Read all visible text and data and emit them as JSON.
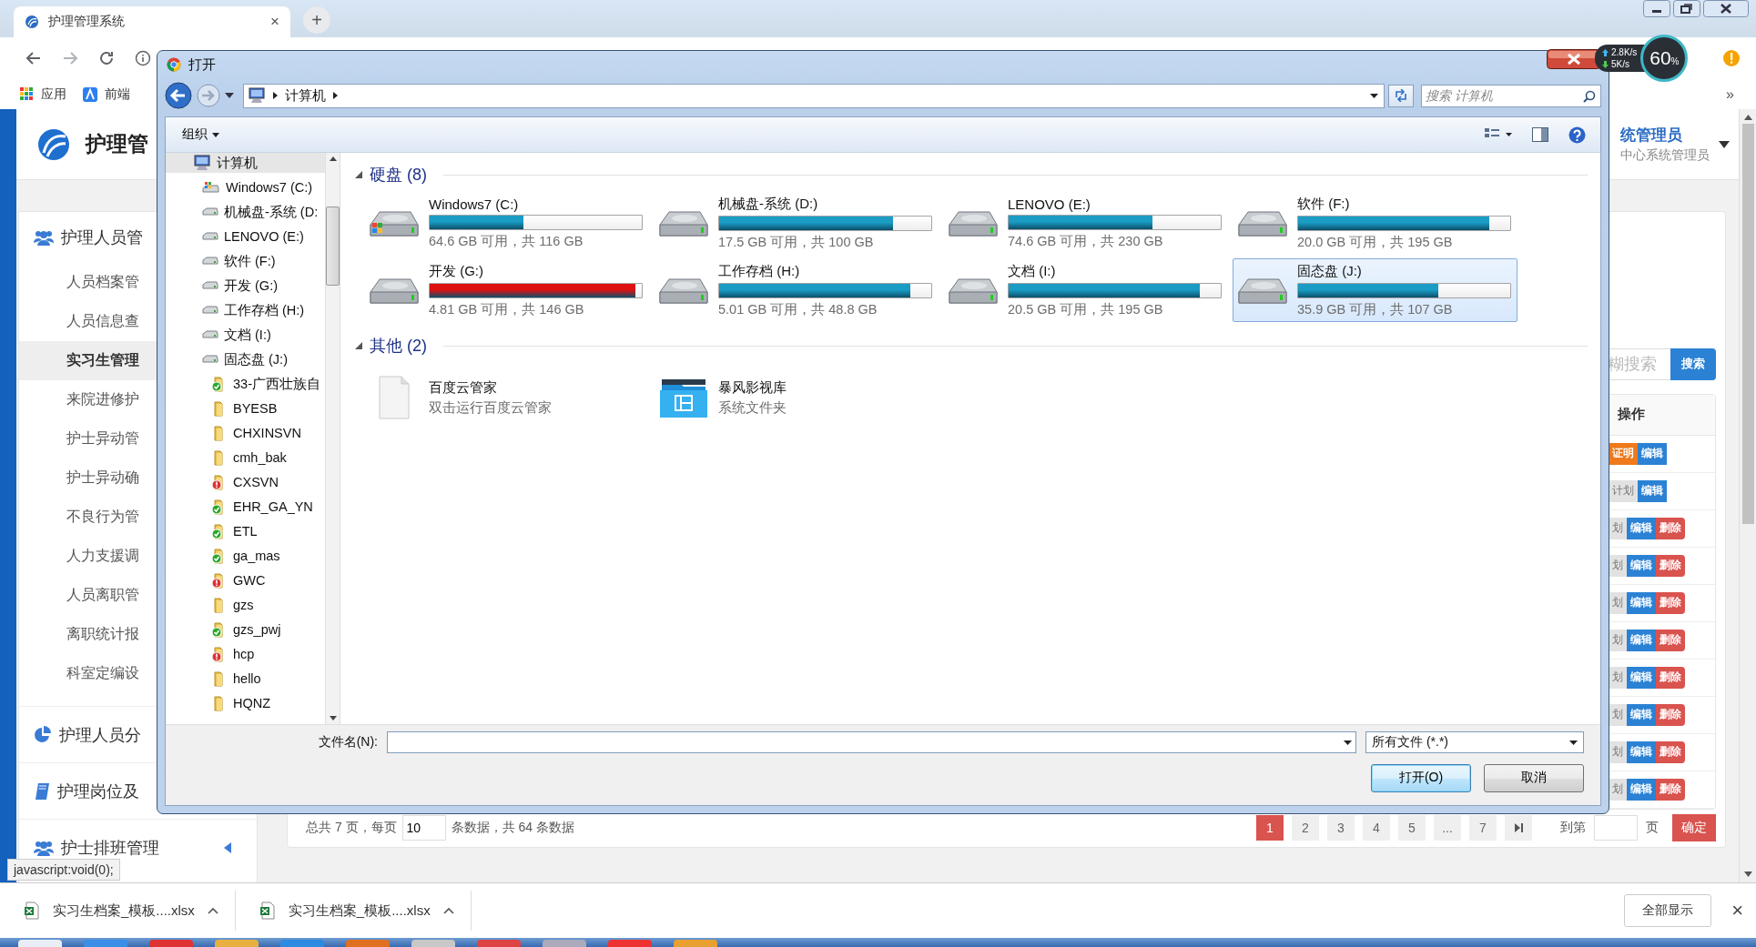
{
  "browser": {
    "tab": {
      "title": "护理管理系统",
      "close": "×"
    },
    "new_tab": "+",
    "bookmarks": [
      {
        "label": "应用",
        "kind": "apps"
      },
      {
        "label": "前端",
        "kind": "page"
      }
    ],
    "overflow": "»"
  },
  "speed_widget": {
    "up": "2.8K/s",
    "down": "5K/s",
    "percent": "60",
    "unit": "%"
  },
  "app": {
    "title": "护理管",
    "user": {
      "name": "统管理员",
      "role": "中心系统管理员"
    },
    "sidebar": [
      {
        "label": "护理人员管",
        "kind": "users",
        "children": [
          {
            "label": "人员档案管",
            "selected": false
          },
          {
            "label": "人员信息查",
            "selected": false
          },
          {
            "label": "实习生管理",
            "selected": true
          },
          {
            "label": "来院进修护",
            "selected": false
          },
          {
            "label": "护士异动管",
            "selected": false
          },
          {
            "label": "护士异动确",
            "selected": false
          },
          {
            "label": "不良行为管",
            "selected": false
          },
          {
            "label": "人力支援调",
            "selected": false
          },
          {
            "label": "人员离职管",
            "selected": false
          },
          {
            "label": "离职统计报",
            "selected": false
          },
          {
            "label": "科室定编设",
            "selected": false
          }
        ]
      },
      {
        "label": "护理人员分",
        "kind": "pie"
      },
      {
        "label": "护理岗位及",
        "kind": "book"
      },
      {
        "label": "护士排班管理",
        "kind": "users",
        "collapsed": true
      }
    ],
    "search": {
      "placeholder": "糊搜索",
      "button": "搜索"
    },
    "table": {
      "column": "操作",
      "rows": [
        {
          "actions": [
            {
              "label": "证明",
              "kind": "warning"
            },
            {
              "label": "编辑",
              "kind": "primary"
            }
          ]
        },
        {
          "actions": [
            {
              "label": "计划",
              "kind": "plain"
            },
            {
              "label": "编辑",
              "kind": "primary"
            }
          ]
        },
        {
          "actions": [
            {
              "label": "划",
              "kind": "plain"
            },
            {
              "label": "编辑",
              "kind": "primary"
            },
            {
              "label": "删除",
              "kind": "danger"
            }
          ]
        },
        {
          "actions": [
            {
              "label": "划",
              "kind": "plain"
            },
            {
              "label": "编辑",
              "kind": "primary"
            },
            {
              "label": "删除",
              "kind": "danger"
            }
          ]
        },
        {
          "actions": [
            {
              "label": "划",
              "kind": "plain"
            },
            {
              "label": "编辑",
              "kind": "primary"
            },
            {
              "label": "删除",
              "kind": "danger"
            }
          ]
        },
        {
          "actions": [
            {
              "label": "划",
              "kind": "plain"
            },
            {
              "label": "编辑",
              "kind": "primary"
            },
            {
              "label": "删除",
              "kind": "danger"
            }
          ]
        },
        {
          "actions": [
            {
              "label": "划",
              "kind": "plain"
            },
            {
              "label": "编辑",
              "kind": "primary"
            },
            {
              "label": "删除",
              "kind": "danger"
            }
          ]
        },
        {
          "actions": [
            {
              "label": "划",
              "kind": "plain"
            },
            {
              "label": "编辑",
              "kind": "primary"
            },
            {
              "label": "删除",
              "kind": "danger"
            }
          ]
        },
        {
          "actions": [
            {
              "label": "划",
              "kind": "plain"
            },
            {
              "label": "编辑",
              "kind": "primary"
            },
            {
              "label": "删除",
              "kind": "danger"
            }
          ]
        },
        {
          "actions": [
            {
              "label": "划",
              "kind": "plain"
            },
            {
              "label": "编辑",
              "kind": "primary"
            },
            {
              "label": "删除",
              "kind": "danger"
            }
          ]
        }
      ]
    },
    "pagination": {
      "summary_prefix": "总共 7 页，每页",
      "page_size": "10",
      "summary_suffix": "条数据，共 64 条数据",
      "pages": [
        {
          "label": "1",
          "selected": true
        },
        {
          "label": "2",
          "selected": false
        },
        {
          "label": "3",
          "selected": false
        },
        {
          "label": "4",
          "selected": false
        },
        {
          "label": "5",
          "selected": false
        },
        {
          "label": "...",
          "selected": false
        },
        {
          "label": "7",
          "selected": false
        }
      ],
      "goto_label": "到第",
      "page_unit": "页",
      "confirm": "确定"
    }
  },
  "dialog": {
    "title": "打开",
    "path": [
      "计算机"
    ],
    "search_placeholder": "搜索 计算机",
    "organize": "组织",
    "tree": [
      {
        "label": "计算机",
        "kind": "computer",
        "selected": true,
        "children": [
          {
            "label": "Windows7 (C:)",
            "kind": "system-drive",
            "selected": false
          },
          {
            "label": "机械盘-系统 (D:",
            "kind": "drive",
            "selected": false
          },
          {
            "label": "LENOVO (E:)",
            "kind": "drive",
            "selected": false
          },
          {
            "label": "软件 (F:)",
            "kind": "drive",
            "selected": false
          },
          {
            "label": "开发 (G:)",
            "kind": "drive",
            "selected": false
          },
          {
            "label": "工作存档 (H:)",
            "kind": "drive",
            "selected": false
          },
          {
            "label": "文档 (I:)",
            "kind": "drive",
            "selected": false
          },
          {
            "label": "固态盘 (J:)",
            "kind": "drive",
            "selected": false,
            "children": [
              {
                "label": "33-广西壮族自",
                "kind": "folder-ok",
                "selected": false
              },
              {
                "label": "BYESB",
                "kind": "folder",
                "selected": false
              },
              {
                "label": "CHXINSVN",
                "kind": "folder",
                "selected": false
              },
              {
                "label": "cmh_bak",
                "kind": "folder",
                "selected": false
              },
              {
                "label": "CXSVN",
                "kind": "folder-error",
                "selected": false
              },
              {
                "label": "EHR_GA_YN",
                "kind": "folder-ok",
                "selected": false
              },
              {
                "label": "ETL",
                "kind": "folder-ok",
                "selected": false
              },
              {
                "label": "ga_mas",
                "kind": "folder-ok",
                "selected": false
              },
              {
                "label": "GWC",
                "kind": "folder-error",
                "selected": false
              },
              {
                "label": "gzs",
                "kind": "folder",
                "selected": false
              },
              {
                "label": "gzs_pwj",
                "kind": "folder-ok",
                "selected": false
              },
              {
                "label": "hcp",
                "kind": "folder-error",
                "selected": false
              },
              {
                "label": "hello",
                "kind": "folder",
                "selected": false
              },
              {
                "label": "HQNZ",
                "kind": "folder",
                "selected": false
              }
            ]
          }
        ]
      }
    ],
    "sections": [
      {
        "title": "硬盘 (8)",
        "kind": "drives",
        "items": [
          {
            "name": "Windows7 (C:)",
            "kind": "system",
            "level": 0.44,
            "free": "64.6 GB 可用，共 116 GB",
            "color": "#1b9cc4",
            "selected": false
          },
          {
            "name": "机械盘-系统 (D:)",
            "kind": "plain",
            "level": 0.82,
            "free": "17.5 GB 可用，共 100 GB",
            "color": "#1b9cc4",
            "selected": false
          },
          {
            "name": "LENOVO (E:)",
            "kind": "plain",
            "level": 0.68,
            "free": "74.6 GB 可用，共 230 GB",
            "color": "#1b9cc4",
            "selected": false
          },
          {
            "name": "软件 (F:)",
            "kind": "plain",
            "level": 0.9,
            "free": "20.0 GB 可用，共 195 GB",
            "color": "#1b9cc4",
            "selected": false
          },
          {
            "name": "开发 (G:)",
            "kind": "plain",
            "level": 0.97,
            "free": "4.81 GB 可用，共 146 GB",
            "color": "#dd1111",
            "selected": false
          },
          {
            "name": "工作存档 (H:)",
            "kind": "plain",
            "level": 0.9,
            "free": "5.01 GB 可用，共 48.8 GB",
            "color": "#1b9cc4",
            "selected": false
          },
          {
            "name": "文档 (I:)",
            "kind": "plain",
            "level": 0.9,
            "free": "20.5 GB 可用，共 195 GB",
            "color": "#1b9cc4",
            "selected": false
          },
          {
            "name": "固态盘 (J:)",
            "kind": "plain",
            "level": 0.66,
            "free": "35.9 GB 可用，共 107 GB",
            "color": "#1b9cc4",
            "selected": true
          }
        ]
      },
      {
        "title": "其他 (2)",
        "kind": "others",
        "items": [
          {
            "name": "百度云管家",
            "detail": "双击运行百度云管家",
            "kind": "file"
          },
          {
            "name": "暴风影视库",
            "detail": "系统文件夹",
            "kind": "library"
          }
        ]
      }
    ],
    "file_name_label": "文件名(N):",
    "filter": "所有文件 (*.*)",
    "buttons": [
      {
        "label": "打开(O)",
        "default": true
      },
      {
        "label": "取消",
        "default": false
      }
    ]
  },
  "status_url": "javascript:void(0);",
  "downloads": {
    "items": [
      {
        "name": "实习生档案_模板....xlsx"
      },
      {
        "name": "实习生档案_模板....xlsx"
      }
    ],
    "show_all": "全部显示",
    "close": "×"
  }
}
